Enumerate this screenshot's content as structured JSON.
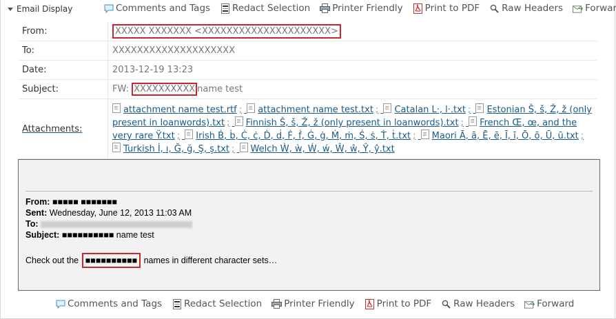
{
  "window": {
    "title": "Email Display"
  },
  "toolbar": {
    "actions": [
      {
        "icon": "comment-icon",
        "label": "Comments and Tags"
      },
      {
        "icon": "redact-icon",
        "label": "Redact Selection"
      },
      {
        "icon": "printer-icon",
        "label": "Printer Friendly"
      },
      {
        "icon": "pdf-icon",
        "label": "Print to PDF"
      },
      {
        "icon": "search-icon",
        "label": "Raw Headers"
      },
      {
        "icon": "forward-icon",
        "label": "Forward"
      }
    ]
  },
  "headers": {
    "from": {
      "label": "From:",
      "value": "XXXXX XXXXXXX <XXXXXXXXXXXXXXXXXXXXX>"
    },
    "to": {
      "label": "To:",
      "value": "XXXXXXXXXXXXXXXXXXXX"
    },
    "date": {
      "label": "Date:",
      "value": "2013-12-19 13:23"
    },
    "subject": {
      "label": "Subject:",
      "prefix": "FW: ",
      "redacted": "XXXXXXXXXX",
      "suffix": "name test"
    },
    "attachments_label": "Attachments:"
  },
  "attachments": [
    "attachment name test.rtf",
    "attachment name test.txt",
    "Catalan L·, l·.txt",
    "Estonian Š, š, Ž, ž (only present in loanwords).txt",
    "Finnish Š, š, Ž, ž (only present in loanwords).txt",
    "French Œ, œ, and the very rare Ÿ.txt",
    "Irish Ḃ, ḃ, Ċ, ċ, Ḋ, ḋ, Ḟ, ḟ, Ġ, ġ, Ṁ, ṁ, Ṡ, ṡ, Ṫ, ṫ.txt",
    "Maori Ā, ā, Ē, ē, Ī, ī, Ō, ō, Ū, ū.txt",
    "Turkish İ, ı, Ğ, ğ, Ş, ş.txt",
    "Welch Ẁ, ẁ, Ẃ, ẃ, Ŵ, ŵ, Ŷ, ŷ.txt"
  ],
  "attachment_separator": ";",
  "message": {
    "from_label": "From:",
    "from_value": "■■■■■ ■■■■■■■",
    "sent_label": "Sent:",
    "sent_value": "Wednesday, June 12, 2013 11:03 AM",
    "to_label": "To:",
    "subject_label": "Subject:",
    "subject_redacted": "■■■■■■■■■■",
    "subject_suffix": " name test",
    "body_prefix": "Check out the ",
    "body_redacted": "■■■■■■■■■■",
    "body_suffix": " names in different character sets…"
  },
  "colors": {
    "redaction_box": "#c8252c",
    "link": "#1a5a86",
    "body_bg": "#f2f2f2"
  }
}
